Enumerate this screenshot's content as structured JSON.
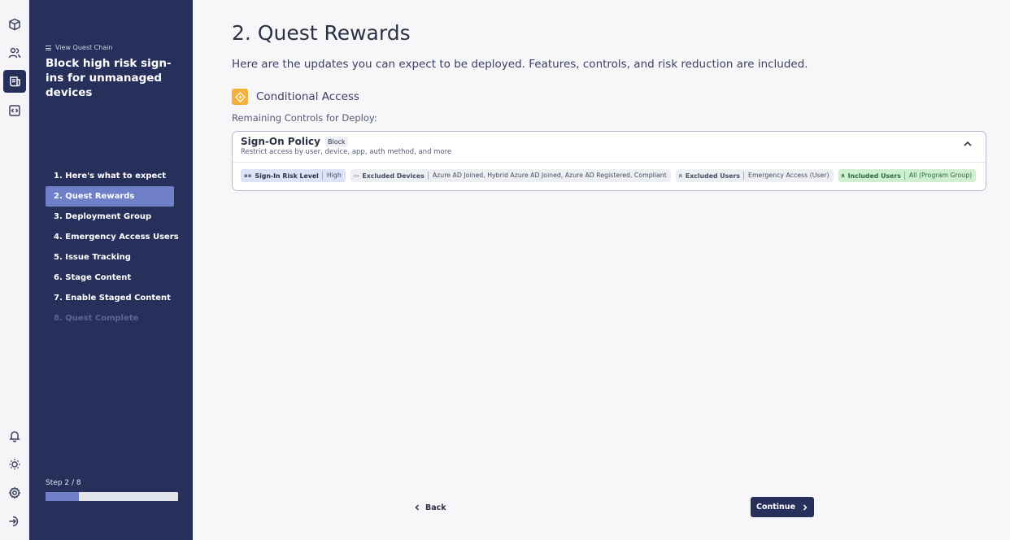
{
  "rail": {
    "top_icons": [
      "cube-icon",
      "users-icon",
      "quests-icon",
      "code-icon"
    ],
    "bottom_icons": [
      "bell-icon",
      "sun-icon",
      "gear-icon",
      "logout-icon"
    ]
  },
  "sidebar": {
    "chain_link": "View Quest Chain",
    "quest_title": "Block high risk sign-ins for unmanaged devices",
    "steps": [
      "1. Here's what to expect",
      "2. Quest Rewards",
      "3. Deployment Group",
      "4. Emergency Access Users",
      "5. Issue Tracking",
      "6. Stage Content",
      "7. Enable Staged Content",
      "8. Quest Complete"
    ],
    "active_step": 1,
    "step_count": "Step 2 / 8",
    "progress_fraction": 0.25
  },
  "main": {
    "title": "2. Quest Rewards",
    "subtitle": "Here are the updates you can expect to be deployed. Features, controls, and risk reduction are included.",
    "section_label": "Conditional Access",
    "remaining_label": "Remaining Controls for Deploy:",
    "policy": {
      "name": "Sign-On Policy",
      "action": "Block",
      "description": "Restrict access by user, device, app, auth method, and more",
      "tags": [
        {
          "key": "Sign-In Risk Level",
          "value": "High"
        },
        {
          "key": "Excluded Devices",
          "value": "Azure AD Joined, Hybrid Azure AD Joined, Azure AD Registered, Compliant"
        },
        {
          "key": "Excluded Users",
          "value": "Emergency Access (User)"
        },
        {
          "key": "Included Users",
          "value": "All (Program Group)"
        }
      ]
    },
    "back_label": "Back",
    "continue_label": "Continue"
  },
  "colors": {
    "sidebar_bg": "#27305a",
    "active_step_bg": "#6f80c8",
    "accent_orange": "#f5b13d",
    "included_green": "#cfeed2"
  }
}
